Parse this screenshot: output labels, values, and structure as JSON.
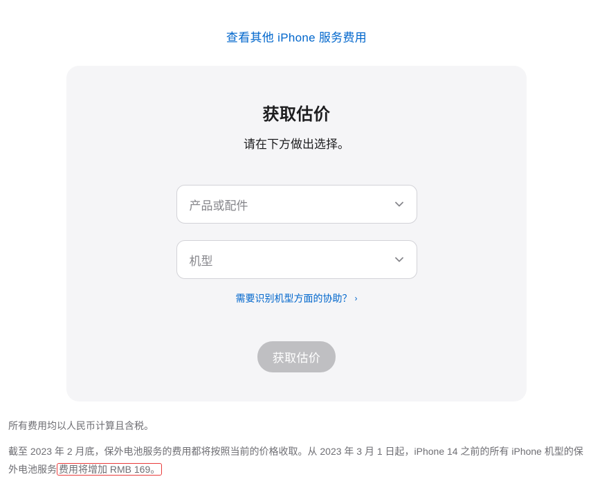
{
  "topLink": {
    "label": "查看其他 iPhone 服务费用"
  },
  "card": {
    "title": "获取估价",
    "subtitle": "请在下方做出选择。",
    "select1Placeholder": "产品或配件",
    "select2Placeholder": "机型",
    "helpLink": "需要识别机型方面的协助？",
    "submitLabel": "获取估价"
  },
  "footer": {
    "note1": "所有费用均以人民币计算且含税。",
    "note2_part1": "截至 2023 年 2 月底，保外电池服务的费用都将按照当前的价格收取。从 2023 年 3 月 1 日起，iPhone 14 之前的所有 iPhone 机型的保外电池服务",
    "note2_highlight": "费用将增加 RMB 169。"
  }
}
